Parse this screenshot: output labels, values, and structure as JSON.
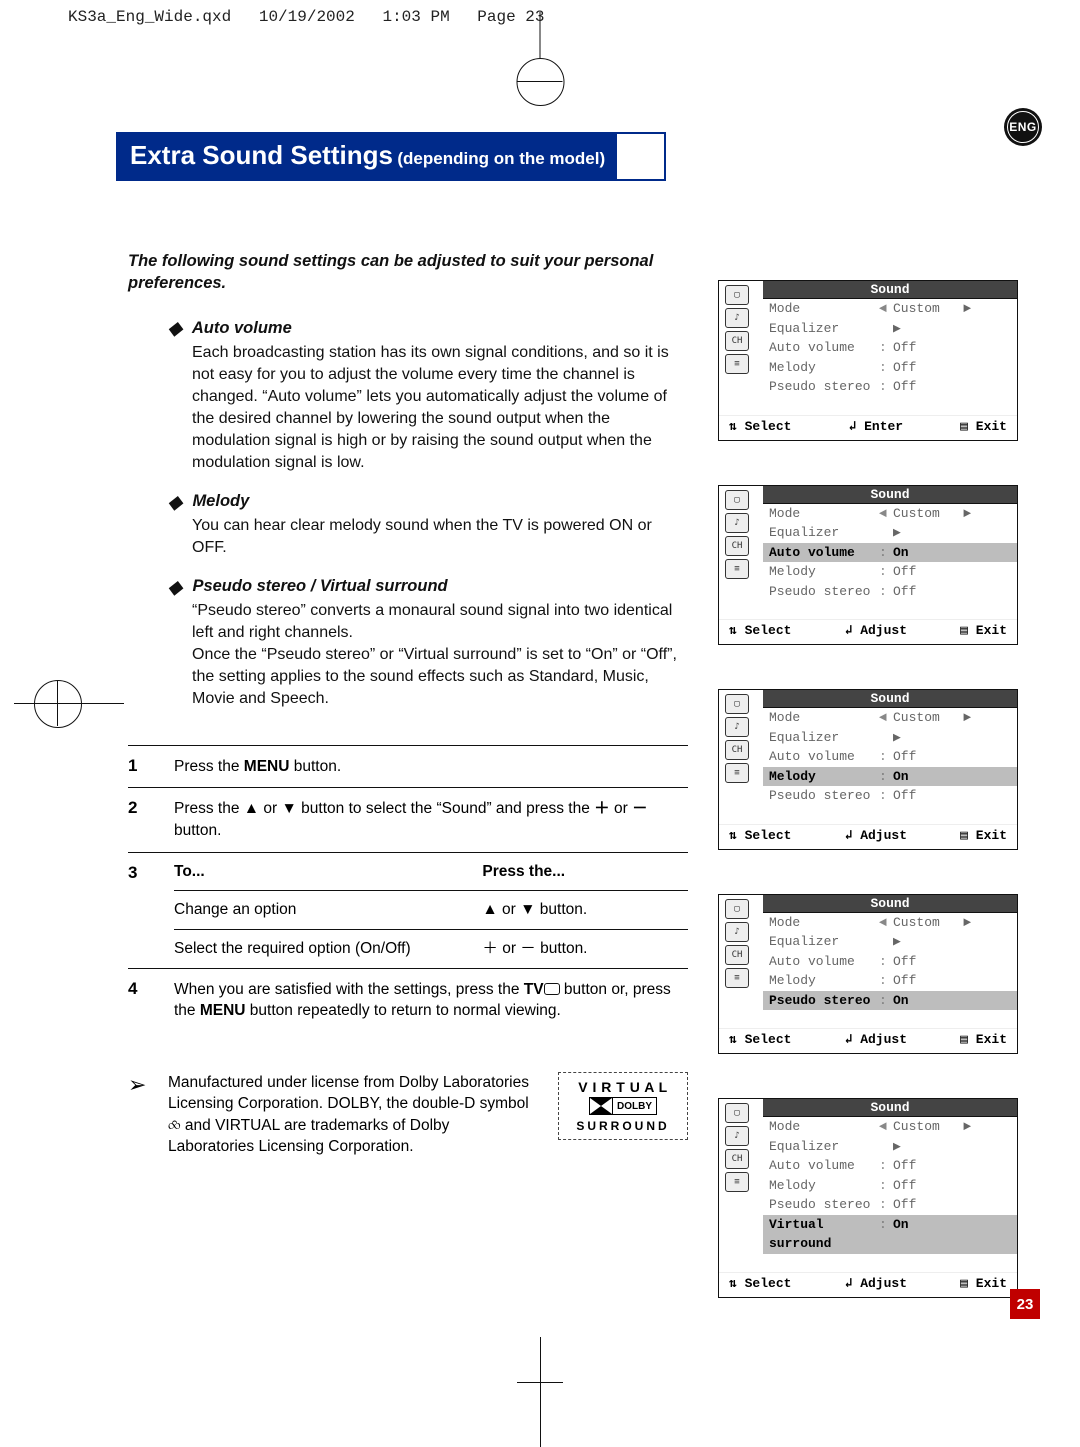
{
  "print_header": {
    "file": "KS3a_Eng_Wide.qxd",
    "date": "10/19/2002",
    "time": "1:03 PM",
    "page": "Page 23"
  },
  "badge": "ENG",
  "title_main": "Extra Sound Settings",
  "title_sub": "(depending on the model)",
  "intro": "The following sound settings can be adjusted to suit your personal preferences.",
  "sec1": {
    "head": "Auto volume",
    "body": "Each broadcasting station has its own signal conditions, and so it is not easy for you to adjust the volume every time the channel is changed. “Auto volume” lets you automatically adjust the volume of the desired channel by lowering the sound output when the modulation signal is high or by raising the sound output when the modulation signal is low."
  },
  "sec2": {
    "head": "Melody",
    "body": "You can hear clear melody sound when the TV is powered ON or OFF."
  },
  "sec3": {
    "head": "Pseudo stereo / Virtual surround",
    "body1": "“Pseudo stereo” converts a monaural sound signal into two identical left and right channels.",
    "body2": "Once the “Pseudo stereo” or “Virtual surround” is set to “On” or “Off”, the setting applies to the sound effects such as Standard, Music, Movie and Speech."
  },
  "steps": {
    "s1_a": "Press the ",
    "s1_b": "MENU",
    "s1_c": " button.",
    "s2_a": "Press the ",
    "s2_b": " or ",
    "s2_c": " button to select the “Sound” and press the ",
    "s2_d": " or ",
    "s2_e": " button.",
    "s3_to": "To...",
    "s3_press": "Press the...",
    "s3_r1a": "Change an option",
    "s3_r1b_a": "▲ or ▼ button.",
    "s3_r2a": "Select the required option (On/Off)",
    "s3_r2b": "＋ or － button.",
    "s4_a": "When you are satisfied with the settings, press the ",
    "s4_b": "TV",
    "s4_c": " button or, press the ",
    "s4_d": "MENU",
    "s4_e": " button repeatedly to return to normal viewing."
  },
  "note": "Manufactured under license from Dolby Laboratories Licensing Corporation. DOLBY, the double-D symbol ⧝ and VIRTUAL are trademarks of Dolby Laboratories Licensing Corporation.",
  "dolby": {
    "virtual": "V I R T U A L",
    "dolby": "DOLBY",
    "surround": "SURROUND"
  },
  "osd_common": {
    "title": "Sound",
    "labels": {
      "mode": "Mode",
      "eq": "Equalizer",
      "av": "Auto volume",
      "mel": "Melody",
      "ps": "Pseudo stereo",
      "vs": "Virtual surround"
    },
    "vals": {
      "custom": "Custom",
      "enter": "▶",
      "off": "Off",
      "on": "On"
    },
    "nav_select": "⇅ Select",
    "nav_enter": "↲ Enter",
    "nav_adjust": "↲ Adjust",
    "nav_exit": "▤ Exit"
  },
  "osd_states": [
    {
      "highlight": "",
      "av": "Off",
      "mel": "Off",
      "ps": "Off",
      "vs": null,
      "nav": "enter"
    },
    {
      "highlight": "av",
      "av": "On",
      "mel": "Off",
      "ps": "Off",
      "vs": null,
      "nav": "adjust"
    },
    {
      "highlight": "mel",
      "av": "Off",
      "mel": "On",
      "ps": "Off",
      "vs": null,
      "nav": "adjust"
    },
    {
      "highlight": "ps",
      "av": "Off",
      "mel": "Off",
      "ps": "On",
      "vs": null,
      "nav": "adjust"
    },
    {
      "highlight": "vs",
      "av": "Off",
      "mel": "Off",
      "ps": "Off",
      "vs": "On",
      "nav": "adjust"
    }
  ],
  "page_number": "23"
}
